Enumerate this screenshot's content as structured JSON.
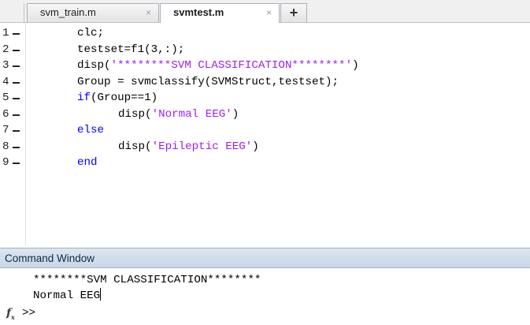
{
  "tabs": [
    {
      "label": "svm_train.m",
      "active": false
    },
    {
      "label": "svmtest.m",
      "active": true
    }
  ],
  "tab_close_glyph": "×",
  "new_tab_glyph": "+",
  "editor": {
    "lines": [
      {
        "num": "1",
        "parts": [
          {
            "t": "clc;",
            "c": "plain"
          }
        ]
      },
      {
        "num": "2",
        "parts": [
          {
            "t": "testset=f1(3,:);",
            "c": "plain"
          }
        ]
      },
      {
        "num": "3",
        "parts": [
          {
            "t": "disp(",
            "c": "plain"
          },
          {
            "t": "'********SVM CLASSIFICATION********'",
            "c": "str"
          },
          {
            "t": ")",
            "c": "plain"
          }
        ]
      },
      {
        "num": "4",
        "parts": [
          {
            "t": "Group = svmclassify(SVMStruct,testset);",
            "c": "plain"
          }
        ]
      },
      {
        "num": "5",
        "parts": [
          {
            "t": "if",
            "c": "kw"
          },
          {
            "t": "(Group==1)",
            "c": "plain"
          }
        ]
      },
      {
        "num": "6",
        "indent": 2,
        "parts": [
          {
            "t": "disp(",
            "c": "plain"
          },
          {
            "t": "'Normal EEG'",
            "c": "str"
          },
          {
            "t": ")",
            "c": "plain"
          }
        ]
      },
      {
        "num": "7",
        "parts": [
          {
            "t": "else",
            "c": "kw"
          }
        ]
      },
      {
        "num": "8",
        "indent": 2,
        "parts": [
          {
            "t": "disp(",
            "c": "plain"
          },
          {
            "t": "'Epileptic EEG'",
            "c": "str"
          },
          {
            "t": ")",
            "c": "plain"
          }
        ]
      },
      {
        "num": "9",
        "parts": [
          {
            "t": "end",
            "c": "kw"
          }
        ]
      }
    ]
  },
  "command_window": {
    "title": "Command Window",
    "output": [
      "********SVM CLASSIFICATION********",
      "Normal EEG"
    ],
    "prompt": ">>",
    "fx_icon": "fx-icon"
  },
  "colors": {
    "keyword": "#0000ff",
    "string": "#a020f0",
    "header_bg": "#c9d6e6"
  }
}
